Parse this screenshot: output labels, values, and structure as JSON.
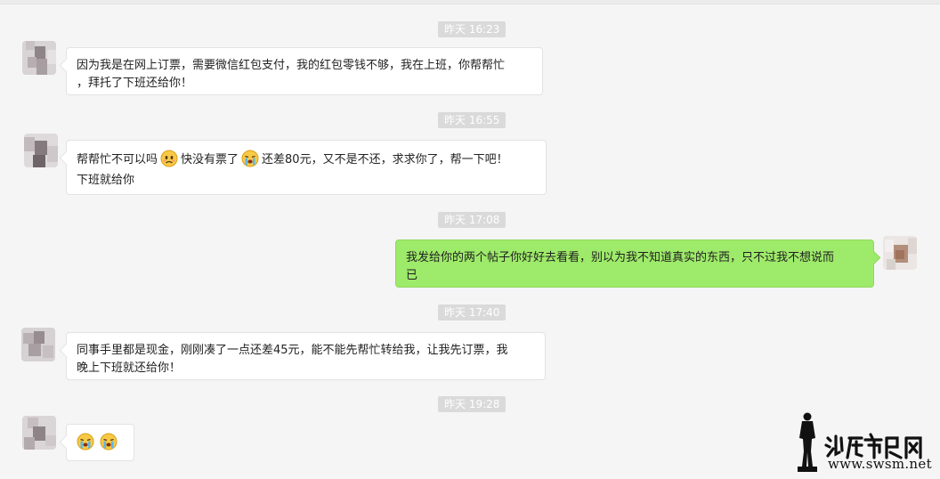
{
  "chat": {
    "timestamps": {
      "t1": "昨天 16:23",
      "t2": "昨天 16:55",
      "t3": "昨天 17:08",
      "t4": "昨天 17:40",
      "t5": "昨天 19:28"
    },
    "messages": {
      "m1": {
        "sender": "contact",
        "line1": "因为我是在网上订票，需要微信红包支付，我的红包零钱不够，我在上班，你帮帮忙",
        "line2": "，拜托了下班还给你！"
      },
      "m2": {
        "sender": "contact",
        "part1": "帮帮忙不可以吗",
        "emoji1": "sad-face-emoji",
        "part2": "快没有票了",
        "emoji2": "crying-face-emoji",
        "part3": "还差80元，又不是不还，求求你了，帮一下吧！",
        "line2": "下班就给你"
      },
      "m3": {
        "sender": "me",
        "line1": "我发给你的两个帖子你好好去看看，别以为我不知道真实的东西，只不过我不想说而",
        "line2": "已"
      },
      "m4": {
        "sender": "contact",
        "line1": "同事手里都是现金，刚刚凑了一点还差45元，能不能先帮忙转给我，让我先订票，我",
        "line2": "晚上下班就还给你！"
      },
      "m5": {
        "sender": "contact",
        "emojis": [
          "crying-face-emoji",
          "crying-face-emoji"
        ]
      }
    }
  },
  "watermark": {
    "logo_text": "汕尾市民网",
    "url": "www.swsm.net"
  },
  "colors": {
    "background": "#f5f5f5",
    "own_bubble": "#9eea6a",
    "other_bubble": "#ffffff",
    "timestamp_bg": "#dadada"
  }
}
